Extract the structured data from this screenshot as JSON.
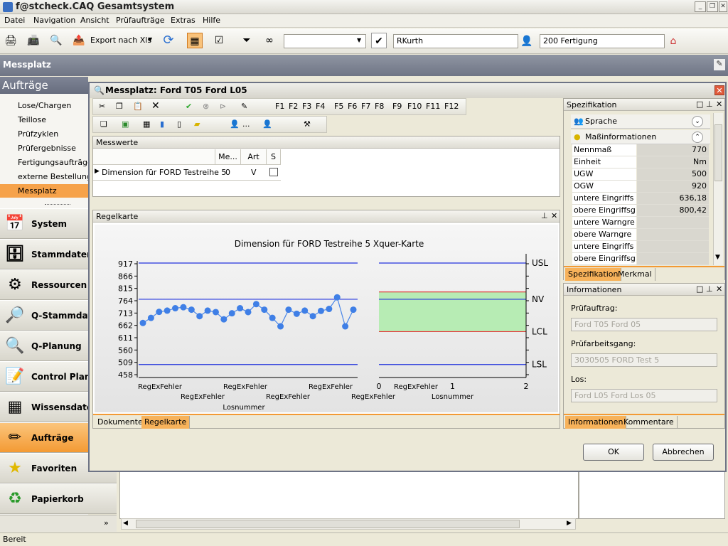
{
  "app": {
    "title": "f@stcheck.CAQ Gesamtsystem"
  },
  "menu": [
    "Datei",
    "Navigation",
    "Ansicht",
    "Prüfaufträge",
    "Extras",
    "Hilfe"
  ],
  "toolbar": {
    "export_label": "Export nach Xls",
    "user": "RKurth",
    "department": "200 Fertigung",
    "combo_value": ""
  },
  "messplatz_bar": {
    "title": "Messplatz"
  },
  "sidebar": {
    "header": "Aufträge",
    "links": [
      "Lose/Chargen",
      "Teillose",
      "Prüfzyklen",
      "Prüfergebnisse",
      "Fertigungsaufträge",
      "externe Bestellungen",
      "Messplatz"
    ],
    "nav": [
      {
        "label": "System",
        "icon": "calendar-icon"
      },
      {
        "label": "Stammdaten",
        "icon": "database-icon"
      },
      {
        "label": "Ressourcen",
        "icon": "gear-icon"
      },
      {
        "label": "Q-Stammdaten",
        "icon": "magnifier-icon"
      },
      {
        "label": "Q-Planung",
        "icon": "planning-icon"
      },
      {
        "label": "Control Plan",
        "icon": "document-plus-icon"
      },
      {
        "label": "Wissensdaten",
        "icon": "grid-icon"
      },
      {
        "label": "Aufträge",
        "icon": "pencil-icon"
      },
      {
        "label": "Favoriten",
        "icon": "star-icon"
      },
      {
        "label": "Papierkorb",
        "icon": "recycle-bin-icon"
      }
    ]
  },
  "status": {
    "text": "Bereit"
  },
  "dialog": {
    "title": "Messplatz: Ford T05 Ford L05",
    "fkeys": [
      "F1",
      "F2",
      "F3",
      "F4",
      "F5",
      "F6",
      "F7",
      "F8",
      "F9",
      "F10",
      "F11",
      "F12"
    ],
    "person_label": "...",
    "messwerte": {
      "title": "Messwerte",
      "columns": [
        "Me...",
        "Art",
        "S"
      ],
      "rows": [
        {
          "name": "Dimension für FORD Testreihe 5",
          "me": "0",
          "art": "V",
          "s": false
        }
      ]
    },
    "regelkarte_title": "Regelkarte",
    "bottom_tabs": [
      "Dokumente",
      "Regelkarte"
    ],
    "spec": {
      "title": "Spezifikation",
      "sections": [
        "Sprache",
        "Maßinformationen"
      ],
      "rows": [
        {
          "k": "Nennmaß",
          "v": "770"
        },
        {
          "k": "Einheit",
          "v": "Nm"
        },
        {
          "k": "UGW",
          "v": "500"
        },
        {
          "k": "OGW",
          "v": "920"
        },
        {
          "k": "untere Eingriffs",
          "v": "636,18"
        },
        {
          "k": "obere Eingriffsg",
          "v": "800,42"
        },
        {
          "k": "untere Warngre",
          "v": ""
        },
        {
          "k": "obere Warngre",
          "v": ""
        },
        {
          "k": "untere Eingriffs",
          "v": ""
        },
        {
          "k": "obere Eingriffsg",
          "v": ""
        }
      ],
      "tabs": [
        "Spezifikation",
        "Merkmal"
      ]
    },
    "info": {
      "title": "Informationen",
      "fields": [
        {
          "label": "Prüfauftrag:",
          "value": "Ford T05 Ford 05"
        },
        {
          "label": "Prüfarbeitsgang:",
          "value": "3030505 FORD Test 5"
        },
        {
          "label": "Los:",
          "value": "Ford L05 Ford Los 05"
        }
      ],
      "tabs": [
        "Informationen",
        "Kommentare"
      ]
    },
    "ok_label": "OK",
    "cancel_label": "Abbrechen"
  },
  "chart_data": {
    "type": "line",
    "title": "Dimension für FORD Testreihe 5  Xquer-Karte",
    "xlabel": "Losnummer",
    "y_ticks": [
      "917",
      "866",
      "815",
      "764",
      "713",
      "662",
      "611",
      "560",
      "509",
      "458"
    ],
    "ylim": [
      458,
      917
    ],
    "x_tick_labels": [
      "RegExFehler",
      "RegExFehler",
      "RegExFehler",
      "RegExFehler",
      "RegExFehler",
      "RegExFehler",
      "RegExFehler"
    ],
    "values": [
      672,
      693,
      718,
      723,
      733,
      737,
      727,
      700,
      723,
      717,
      687,
      712,
      733,
      717,
      750,
      727,
      693,
      658,
      727,
      710,
      723,
      700,
      722,
      730,
      778,
      658,
      727
    ],
    "lines": {
      "USL": 920,
      "NV": 770,
      "LCL": 636.18,
      "LSL": 500,
      "UCL": 800.42
    },
    "limit_labels": [
      "USL",
      "NV",
      "LCL",
      "LSL"
    ],
    "distribution": {
      "xlabel": "Losnummer",
      "x_ticks": [
        "0",
        "1",
        "2"
      ]
    }
  }
}
